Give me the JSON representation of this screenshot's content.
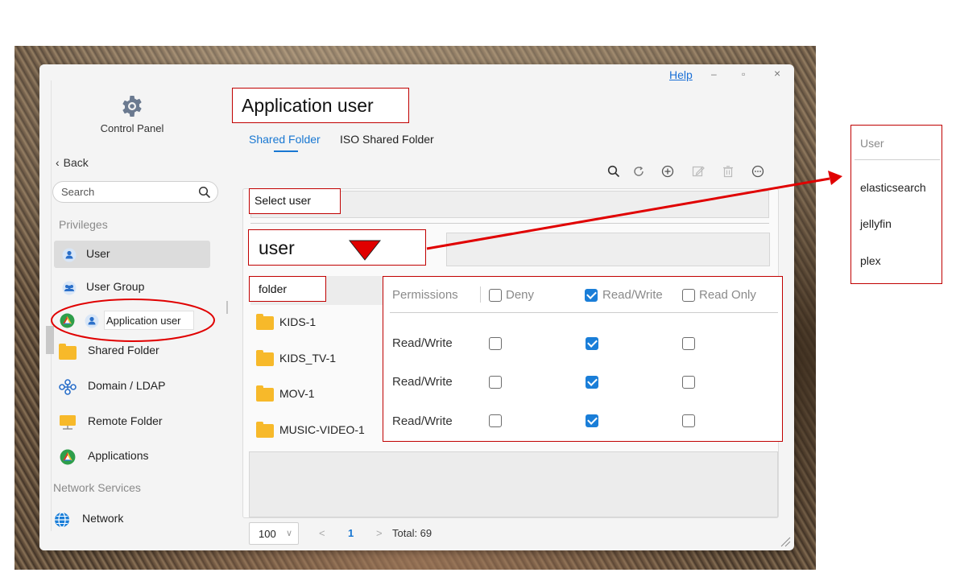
{
  "window": {
    "help_label": "Help",
    "minimize": "–",
    "maximize": "▫",
    "close": "×"
  },
  "sidebar": {
    "title": "Control Panel",
    "back_label": "Back",
    "search_placeholder": "Search",
    "sections": {
      "privileges": "Privileges",
      "network_services": "Network Services"
    },
    "items": [
      {
        "label": "User",
        "icon": "user-icon"
      },
      {
        "label": "User Group",
        "icon": "user-group-icon"
      },
      {
        "label": "Application user",
        "icon": "app-user-icon"
      },
      {
        "label": "Shared Folder",
        "icon": "folder-icon"
      },
      {
        "label": "Domain / LDAP",
        "icon": "domain-icon"
      },
      {
        "label": "Remote Folder",
        "icon": "remote-folder-icon"
      },
      {
        "label": "Applications",
        "icon": "applications-icon"
      },
      {
        "label": "Network",
        "icon": "network-icon"
      }
    ]
  },
  "main": {
    "title": "Application user",
    "tabs": [
      {
        "label": "Shared Folder",
        "active": true
      },
      {
        "label": "ISO Shared Folder",
        "active": false
      }
    ],
    "toolbar_icons": [
      "search-icon",
      "refresh-icon",
      "add-icon",
      "edit-icon",
      "delete-icon",
      "more-icon"
    ],
    "select_user_label": "Select user",
    "user_label": "user",
    "folder_label": "folder",
    "folders": [
      "KIDS-1",
      "KIDS_TV-1",
      "MOV-1",
      "MUSIC-VIDEO-1"
    ],
    "permissions": {
      "header": "Permissions",
      "columns": [
        "Deny",
        "Read/Write",
        "Read Only"
      ],
      "header_checked": [
        false,
        true,
        false
      ],
      "rows": [
        {
          "label": "Read/Write",
          "checked": [
            false,
            true,
            false
          ]
        },
        {
          "label": "Read/Write",
          "checked": [
            false,
            true,
            false
          ]
        },
        {
          "label": "Read/Write",
          "checked": [
            false,
            true,
            false
          ]
        }
      ]
    },
    "pager": {
      "page_size": "100",
      "prev": "<",
      "page": "1",
      "next": ">",
      "total": "Total: 69"
    }
  },
  "user_dropdown": {
    "header": "User",
    "options": [
      "elasticsearch",
      "jellyfin",
      "plex"
    ]
  },
  "colors": {
    "accent": "#1877d2",
    "annotation": "#c00000",
    "arrow": "#e00000"
  }
}
